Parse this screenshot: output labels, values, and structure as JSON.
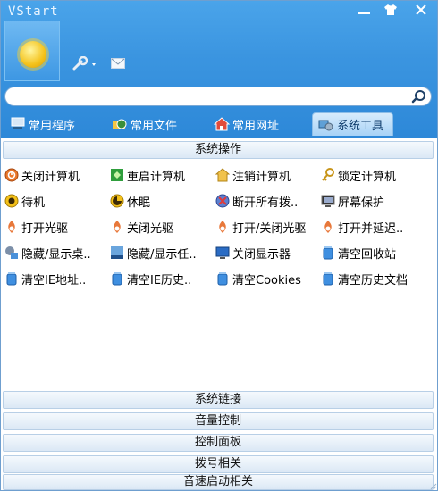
{
  "window": {
    "title": "VStart"
  },
  "search": {
    "value": "",
    "placeholder": ""
  },
  "tabs": [
    {
      "label": "常用程序",
      "icon": "computer-icon"
    },
    {
      "label": "常用文件",
      "icon": "folder-globe-icon"
    },
    {
      "label": "常用网址",
      "icon": "home-icon"
    },
    {
      "label": "系统工具",
      "icon": "system-tools-icon",
      "active": true
    }
  ],
  "open_section": {
    "title": "系统操作",
    "items": [
      {
        "label": "关闭计算机",
        "icon": "power-off-icon"
      },
      {
        "label": "重启计算机",
        "icon": "restart-icon"
      },
      {
        "label": "注销计算机",
        "icon": "logoff-icon"
      },
      {
        "label": "锁定计算机",
        "icon": "key-icon"
      },
      {
        "label": "待机",
        "icon": "standby-icon"
      },
      {
        "label": "休眠",
        "icon": "hibernate-icon"
      },
      {
        "label": "断开所有拨..",
        "icon": "disconnect-icon"
      },
      {
        "label": "屏幕保护",
        "icon": "screensaver-icon"
      },
      {
        "label": "打开光驱",
        "icon": "cd-drive-icon"
      },
      {
        "label": "关闭光驱",
        "icon": "cd-drive-icon"
      },
      {
        "label": "打开/关闭光驱",
        "icon": "cd-drive-icon"
      },
      {
        "label": "打开并延迟..",
        "icon": "cd-drive-icon"
      },
      {
        "label": "隐藏/显示桌..",
        "icon": "desktop-icon"
      },
      {
        "label": "隐藏/显示任..",
        "icon": "taskbar-icon"
      },
      {
        "label": "关闭显示器",
        "icon": "monitor-icon"
      },
      {
        "label": "清空回收站",
        "icon": "trash-icon"
      },
      {
        "label": "清空IE地址..",
        "icon": "trash-icon"
      },
      {
        "label": "清空IE历史..",
        "icon": "trash-icon"
      },
      {
        "label": "清空Cookies",
        "icon": "trash-icon"
      },
      {
        "label": "清空历史文档",
        "icon": "trash-icon"
      }
    ]
  },
  "collapsed_sections": [
    "系统链接",
    "音量控制",
    "控制面板",
    "拨号相关",
    "音速启动相关"
  ]
}
